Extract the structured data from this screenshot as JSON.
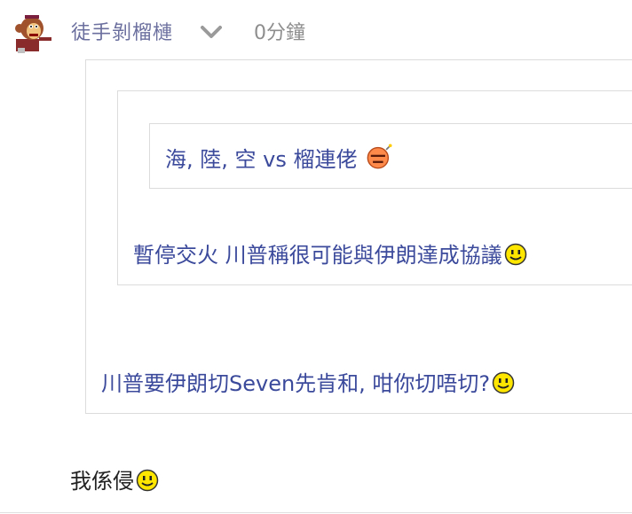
{
  "post": {
    "username": "徒手剝榴槤",
    "time": "0分鐘",
    "avatar_icon": "monkey-avatar-icon",
    "menu_icon": "chevron-down-icon"
  },
  "quotes": {
    "level3": {
      "text": "海, 陸, 空 vs 榴連佬",
      "emoji": "angry-bomb-emoji-icon"
    },
    "level2": {
      "text": "暫停交火 川普稱很可能與伊朗達成協議",
      "emoji": "smile-emoji-icon"
    },
    "level1": {
      "text": "川普要伊朗切Seven先肯和, 咁你切唔切?",
      "emoji": "smile-emoji-icon"
    }
  },
  "reply": {
    "text": "我係侵",
    "emoji": "smile-emoji-icon"
  },
  "colors": {
    "quote_text": "#3c4a9c",
    "username": "#6b6f9e",
    "border": "#dcdcdc"
  }
}
